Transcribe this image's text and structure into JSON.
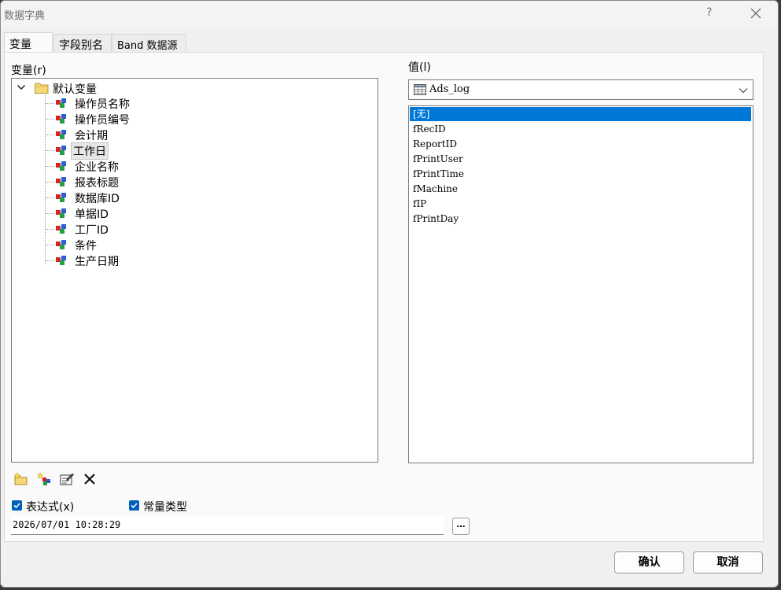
{
  "window": {
    "title": "数据字典",
    "help_label": "?"
  },
  "tabs": [
    {
      "label": "变量",
      "active": true
    },
    {
      "label": "字段别名",
      "active": false
    },
    {
      "label": "Band 数据源",
      "active": false
    }
  ],
  "left": {
    "label": "变量(r)",
    "tree": {
      "root": "默认变量",
      "items": [
        "操作员名称",
        "操作员编号",
        "会计期",
        "工作日",
        "企业名称",
        "报表标题",
        "数据库ID",
        "单据ID",
        "工厂ID",
        "条件",
        "生产日期"
      ],
      "selected_index": 3
    }
  },
  "right": {
    "label": "值(l)",
    "combo_value": "Ads_log",
    "fields": [
      "[无]",
      "fRecID",
      "ReportID",
      "fPrintUser",
      "fPrintTime",
      "fMachine",
      "fIP",
      "fPrintDay"
    ],
    "selected_index": 0
  },
  "toolbar": {
    "icons": [
      "new-folder-icon",
      "new-variable-icon",
      "edit-properties-icon",
      "delete-icon"
    ]
  },
  "options": {
    "expression_label": "表达式(x)",
    "expression_checked": true,
    "constant_label": "常量类型",
    "constant_checked": true
  },
  "expression_value": "2026/07/01 10:28:29",
  "ellipsis_label": "…",
  "buttons": {
    "ok": "确认",
    "cancel": "取消"
  },
  "colors": {
    "selection": "#0078d7",
    "checkbox": "#005fb8"
  }
}
